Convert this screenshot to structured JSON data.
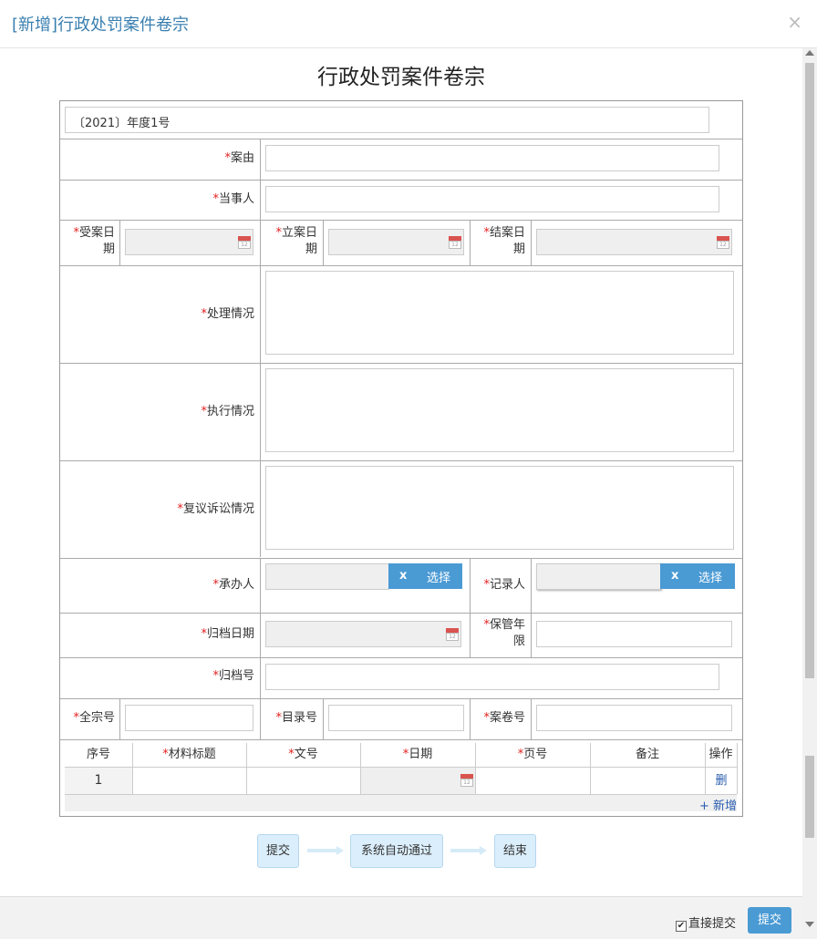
{
  "modal": {
    "title": "[新增]行政处罚案件卷宗",
    "close": "×"
  },
  "doc_title": "行政处罚案件卷宗",
  "year_field": "〔2021〕年度1号",
  "labels": {
    "case_reason": "案由",
    "party": "当事人",
    "accept_date": [
      "受案日",
      "期"
    ],
    "file_date": [
      "立案日",
      "期"
    ],
    "close_date": [
      "结案日",
      "期"
    ],
    "handling": "处理情况",
    "execution": "执行情况",
    "review": "复议诉讼情况",
    "undertaker": "承办人",
    "recorder": "记录人",
    "archive_date": "归档日期",
    "retention": [
      "保管年",
      "限"
    ],
    "archive_no": "归档号",
    "fonds_no": "全宗号",
    "catalog_no": "目录号",
    "volume_no": "案卷号"
  },
  "required_mark": "*",
  "select_btn": {
    "clear": "x",
    "label": "选择"
  },
  "materials": {
    "headers": [
      "序号",
      "材料标题",
      "文号",
      "日期",
      "页号",
      "备注",
      "操作"
    ],
    "required": [
      false,
      true,
      true,
      true,
      true,
      false,
      false
    ],
    "rows": [
      {
        "index": "1",
        "delete": "删"
      }
    ],
    "add": "+ 新增"
  },
  "flow": {
    "steps": [
      "提交",
      "系统自动通过",
      "结束"
    ]
  },
  "footer": {
    "checkbox_label": "直接提交",
    "checkbox_mark": "✔",
    "submit": "提交"
  },
  "colors": {
    "accent": "#4a9ad4",
    "title": "#3a7fb0",
    "required": "#e02020"
  }
}
